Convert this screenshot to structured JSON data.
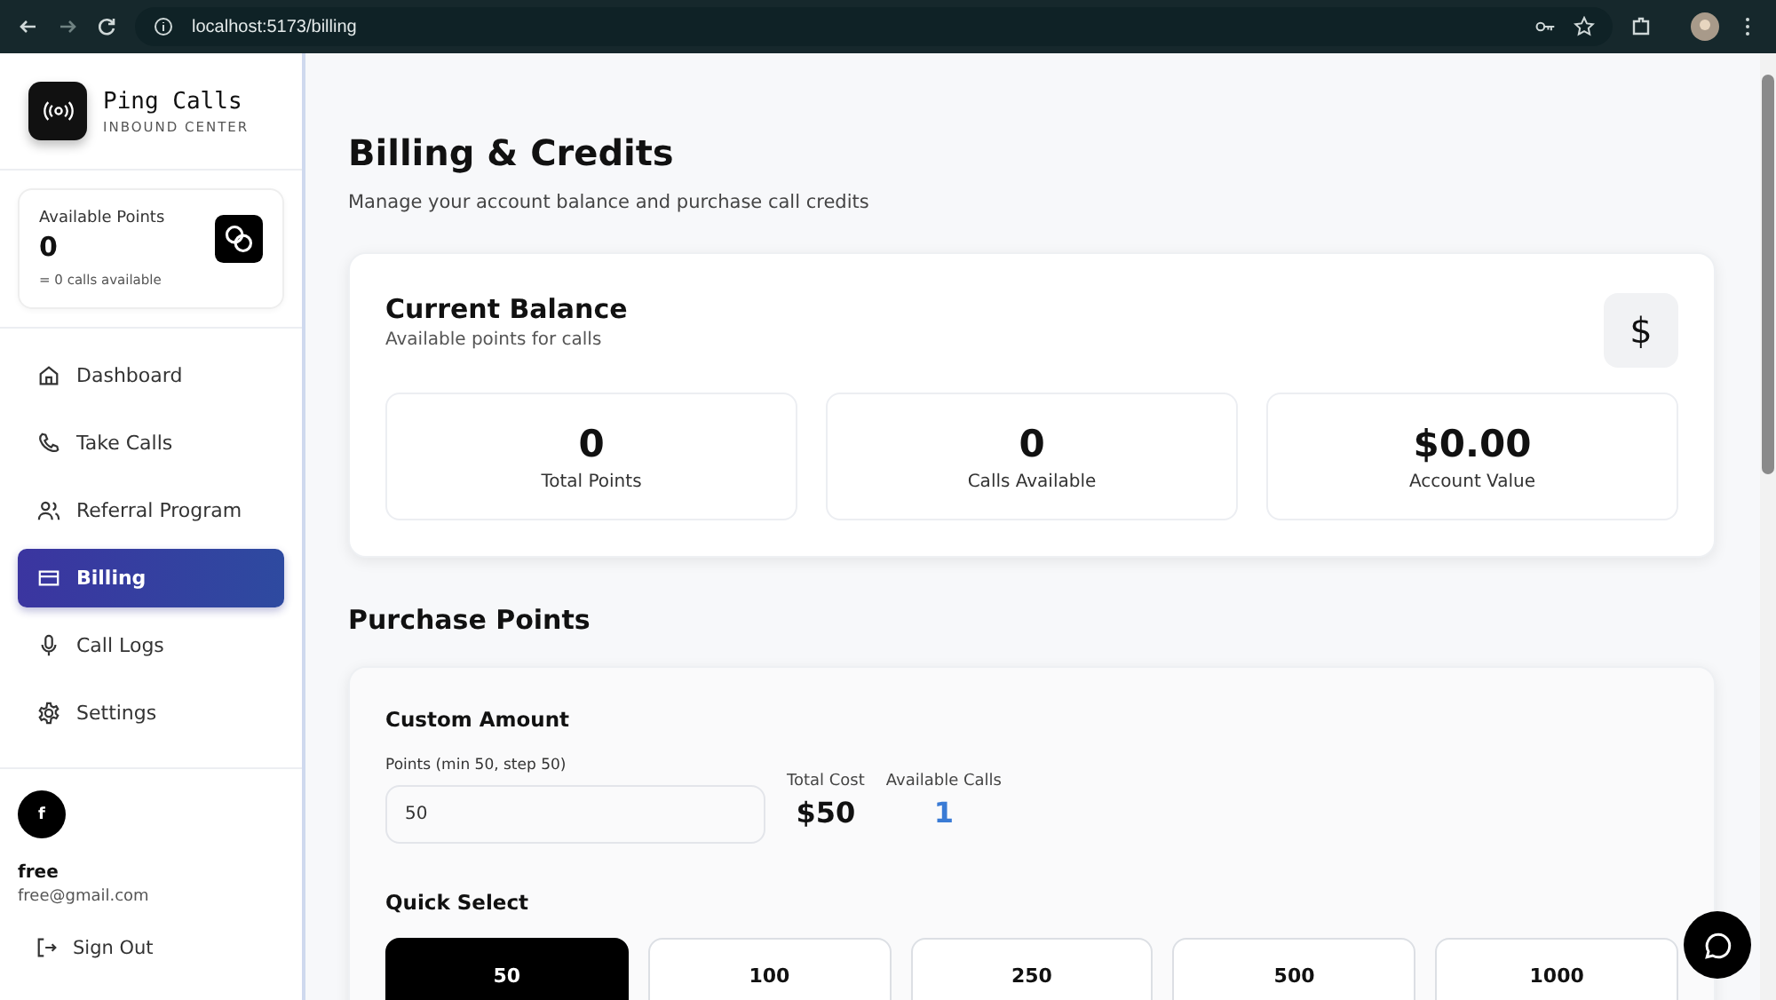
{
  "browser": {
    "url": "localhost:5173/billing"
  },
  "sidebar": {
    "brand": {
      "name": "Ping Calls",
      "subtitle": "INBOUND CENTER"
    },
    "points_card": {
      "label": "Available Points",
      "value": "0",
      "note": "= 0 calls available"
    },
    "items": [
      {
        "label": "Dashboard",
        "selected": false
      },
      {
        "label": "Take Calls",
        "selected": false
      },
      {
        "label": "Referral Program",
        "selected": false
      },
      {
        "label": "Billing",
        "selected": true
      },
      {
        "label": "Call Logs",
        "selected": false
      },
      {
        "label": "Settings",
        "selected": false
      }
    ],
    "user": {
      "initial": "f",
      "name": "free",
      "email": "free@gmail.com"
    },
    "sign_out": "Sign Out"
  },
  "page": {
    "title": "Billing & Credits",
    "subtitle": "Manage your account balance and purchase call credits"
  },
  "balance": {
    "title": "Current Balance",
    "subtitle": "Available points for calls",
    "icon": "$",
    "stats": [
      {
        "value": "0",
        "label": "Total Points"
      },
      {
        "value": "0",
        "label": "Calls Available"
      },
      {
        "value": "$0.00",
        "label": "Account Value"
      }
    ]
  },
  "purchase": {
    "heading": "Purchase Points",
    "custom_title": "Custom Amount",
    "field_label": "Points (min 50, step 50)",
    "field_value": "50",
    "total_cost_label": "Total Cost",
    "total_cost": "$50",
    "calls_label": "Available Calls",
    "calls": "1",
    "quick_title": "Quick Select",
    "options": [
      {
        "label": "50",
        "selected": true
      },
      {
        "label": "100",
        "selected": false
      },
      {
        "label": "250",
        "selected": false
      },
      {
        "label": "500",
        "selected": false
      },
      {
        "label": "1000",
        "selected": false
      }
    ]
  }
}
